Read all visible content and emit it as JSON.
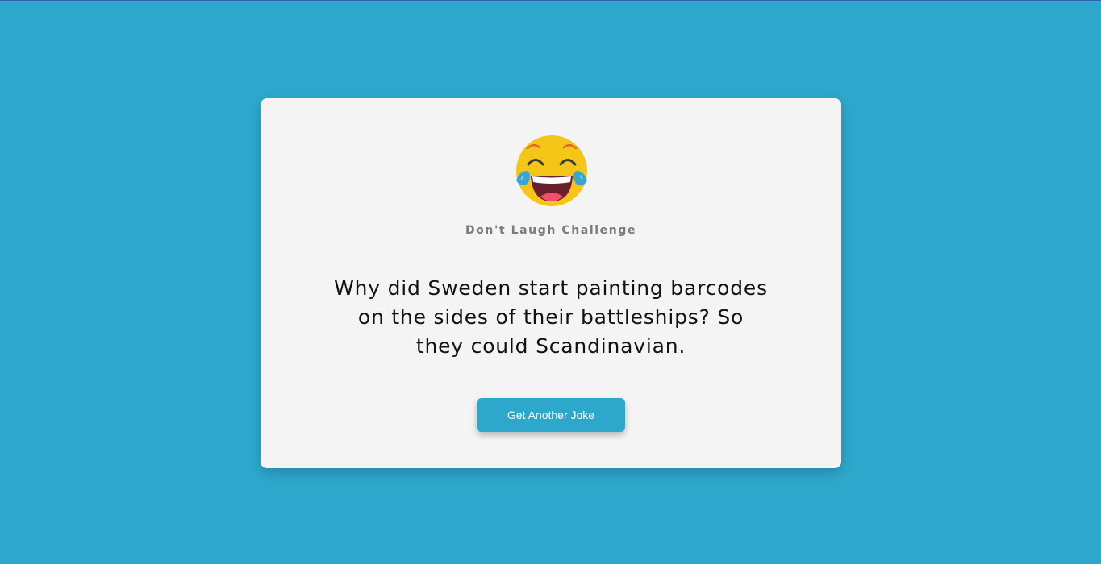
{
  "app": {
    "subtitle": "Don't Laugh Challenge",
    "joke": "Why did Sweden start painting barcodes on the sides of their battleships? So they could Scandinavian.",
    "button_label": "Get Another Joke",
    "emoji_icon": "laughing-tears-emoji-icon"
  },
  "colors": {
    "background": "#2ea7cc",
    "card": "#f4f4f4",
    "button": "#2ea7cc",
    "button_text": "#ffffff",
    "subtitle": "#7a7a7a"
  }
}
